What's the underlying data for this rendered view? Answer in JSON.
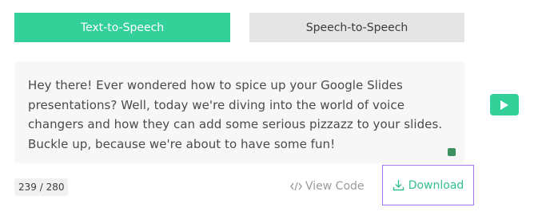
{
  "tabs": {
    "active_label": "Text-to-Speech",
    "inactive_label": "Speech-to-Speech"
  },
  "editor": {
    "text": "Hey there! Ever wondered how to spice up your Google Slides presentations? Well, today we're diving into the world of voice changers and how they can add some serious pizzazz to your slides. Buckle up, because we're about to have some fun!"
  },
  "footer": {
    "char_count": "239 / 280",
    "view_code_label": "View Code",
    "download_label": "Download"
  },
  "icons": {
    "play": "play-icon",
    "code": "code-icon",
    "download": "download-icon"
  },
  "colors": {
    "accent": "#34d09a",
    "highlight_border": "#a774f0"
  }
}
